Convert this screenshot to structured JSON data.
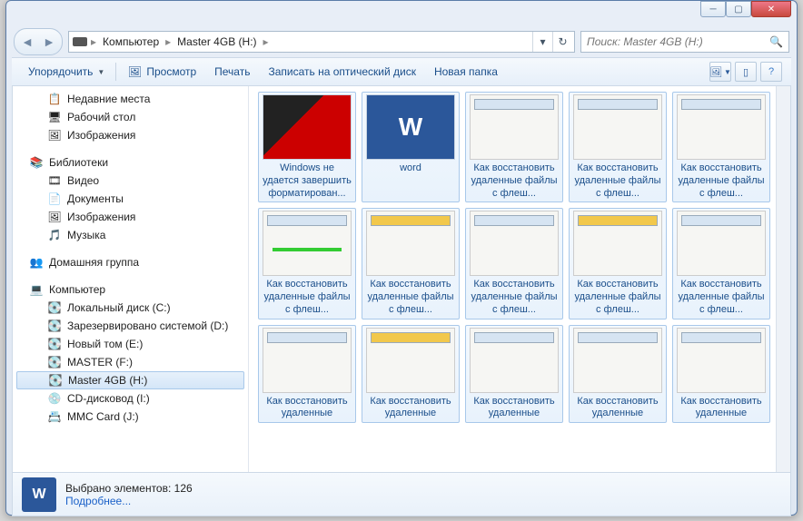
{
  "titlebar": {
    "min": "─",
    "max": "▢",
    "close": "✕"
  },
  "nav": {
    "back": "◄",
    "fwd": "►"
  },
  "breadcrumb": {
    "root": "Компьютер",
    "drive": "Master 4GB (H:)"
  },
  "search": {
    "placeholder": "Поиск: Master 4GB (H:)"
  },
  "toolbar": {
    "organize": "Упорядочить",
    "preview": "Просмотр",
    "print": "Печать",
    "burn": "Записать на оптический диск",
    "newfolder": "Новая папка"
  },
  "sidebar": {
    "recent": "Недавние места",
    "desktop": "Рабочий стол",
    "pictures": "Изображения",
    "libraries": "Библиотеки",
    "videos": "Видео",
    "documents": "Документы",
    "pictures2": "Изображения",
    "music": "Музыка",
    "homegroup": "Домашняя группа",
    "computer": "Компьютер",
    "localc": "Локальный диск (C:)",
    "reserved": "Зарезервировано системой (D:)",
    "newvol": "Новый том (E:)",
    "masterf": "MASTER (F:)",
    "master4": "Master 4GB (H:)",
    "cddrive": "CD-дисковод (I:)",
    "mmc": "MMC Card (J:)"
  },
  "items": [
    {
      "cap": "Windows не удается завершить форматирован...",
      "th": "th-usb"
    },
    {
      "cap": "word",
      "th": "th-word"
    },
    {
      "cap": "Как восстановить удаленные файлы с флеш...",
      "th": "th-app"
    },
    {
      "cap": "Как восстановить удаленные файлы с флеш...",
      "th": "th-app"
    },
    {
      "cap": "Как восстановить удаленные файлы с флеш...",
      "th": "th-app"
    },
    {
      "cap": "Как восстановить удаленные файлы с флеш...",
      "th": "th-app th-green"
    },
    {
      "cap": "Как восстановить удаленные файлы с флеш...",
      "th": "th-app th-yellow"
    },
    {
      "cap": "Как восстановить удаленные файлы с флеш...",
      "th": "th-app"
    },
    {
      "cap": "Как восстановить удаленные файлы с флеш...",
      "th": "th-app th-yellow"
    },
    {
      "cap": "Как восстановить удаленные файлы с флеш...",
      "th": "th-app"
    },
    {
      "cap": "Как восстановить удаленные",
      "th": "th-app"
    },
    {
      "cap": "Как восстановить удаленные",
      "th": "th-app th-yellow"
    },
    {
      "cap": "Как восстановить удаленные",
      "th": "th-app"
    },
    {
      "cap": "Как восстановить удаленные",
      "th": "th-app"
    },
    {
      "cap": "Как восстановить удаленные",
      "th": "th-app"
    }
  ],
  "details": {
    "selected": "Выбрано элементов: 126",
    "more": "Подробнее..."
  }
}
